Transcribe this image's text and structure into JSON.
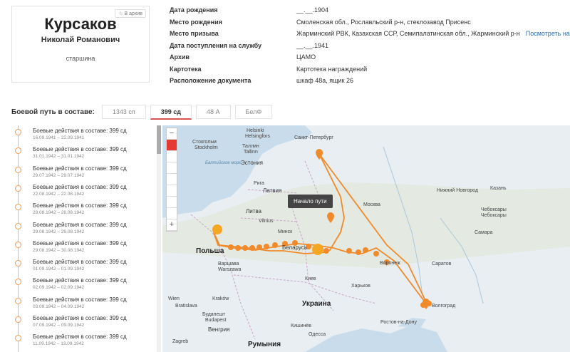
{
  "profile": {
    "surname": "Курсаков",
    "given_names": "Николай Романович",
    "rank": "старшина",
    "archive_badge": "☆ В архив"
  },
  "info": [
    {
      "label": "Дата рождения",
      "value": "__.__.1904"
    },
    {
      "label": "Место рождения",
      "value": "Смоленская обл., Рославльский р-н, стеклозавод Присенс"
    },
    {
      "label": "Место призыва",
      "value": "Жарминский РВК, Казахская ССР, Семипалатинская обл., Жарминский р-н",
      "link": "Посмотреть на карте"
    },
    {
      "label": "Дата поступления на службу",
      "value": "__.__.1941"
    },
    {
      "label": "Архив",
      "value": "ЦАМО"
    },
    {
      "label": "Картотека",
      "value": "Картотека награждений"
    },
    {
      "label": "Расположение документа",
      "value": "шкаф 48а, ящик 26"
    }
  ],
  "route": {
    "title": "Боевой путь в составе:",
    "tabs": [
      {
        "label": "1343 сп",
        "active": false
      },
      {
        "label": "399 сд",
        "active": true
      },
      {
        "label": "48 А",
        "active": false
      },
      {
        "label": "БелФ",
        "active": false
      }
    ]
  },
  "events": [
    {
      "title": "Боевые действия в составе: 399 сд",
      "dates": "16.09.1941 – 22.09.1941"
    },
    {
      "title": "Боевые действия в составе: 399 сд",
      "dates": "31.01.1942 – 31.01.1942"
    },
    {
      "title": "Боевые действия в составе: 399 сд",
      "dates": "29.07.1942 – 29.07.1942"
    },
    {
      "title": "Боевые действия в составе: 399 сд",
      "dates": "22.08.1942 – 22.08.1942"
    },
    {
      "title": "Боевые действия в составе: 399 сд",
      "dates": "28.08.1942 – 28.08.1942"
    },
    {
      "title": "Боевые действия в составе: 399 сд",
      "dates": "29.08.1942 – 29.08.1942"
    },
    {
      "title": "Боевые действия в составе: 399 сд",
      "dates": "29.08.1942 – 30.08.1942"
    },
    {
      "title": "Боевые действия в составе: 399 сд",
      "dates": "01.09.1942 – 01.09.1942"
    },
    {
      "title": "Боевые действия в составе: 399 сд",
      "dates": "02.09.1942 – 02.09.1942"
    },
    {
      "title": "Боевые действия в составе: 399 сд",
      "dates": "03.09.1942 – 04.09.1942"
    },
    {
      "title": "Боевые действия в составе: 399 сд",
      "dates": "07.09.1942 – 09.09.1942"
    },
    {
      "title": "Боевые действия в составе: 399 сд",
      "dates": "11.09.1942 – 13.09.1942"
    }
  ],
  "map": {
    "tooltip": "Начало пути",
    "zoom_in": "−",
    "zoom_out": "+",
    "labels": {
      "helsinki": "Helsinki",
      "helsingfors": "Helsingfors",
      "saint_petersburg": "Санкт-Петербург",
      "stockholm": "Стокгольм",
      "stockholm_lat": "Stockholm",
      "tallinn_ru": "Таллин",
      "tallinn": "Tallinn",
      "estonia": "Эстония",
      "baltic_sea": "Балтийское море",
      "riga": "Рига",
      "latvia": "Латвия",
      "lithuania": "Литва",
      "vilnius": "Vilnius",
      "minsk": "Минск",
      "moscow": "Москва",
      "poland": "Польша",
      "belarus": "Беларусь",
      "warsaw": "Варшава",
      "warszawa": "Warszawa",
      "kyiv": "Киев",
      "ukraine": "Украина",
      "kharkiv": "Харьков",
      "voronezh": "Воронеж",
      "saratov": "Саратов",
      "samara": "Самара",
      "kazan": "Казань",
      "n_novgorod": "Нижний Новгород",
      "cheboksary": "Чебоксары",
      "cheboksary2": "Чебоксары",
      "volgograd": "Волгоград",
      "rostov": "Ростов-на-Дону",
      "budapest_ru": "Будапешт",
      "budapest": "Budapest",
      "hungary": "Венгрия",
      "romania": "Румыния",
      "zagreb": "Zagreb",
      "bratislava": "Bratislava",
      "krakow": "Kraków",
      "vienna": "Wien",
      "chisinau": "Кишинёв",
      "odesa": "Одесса"
    }
  }
}
